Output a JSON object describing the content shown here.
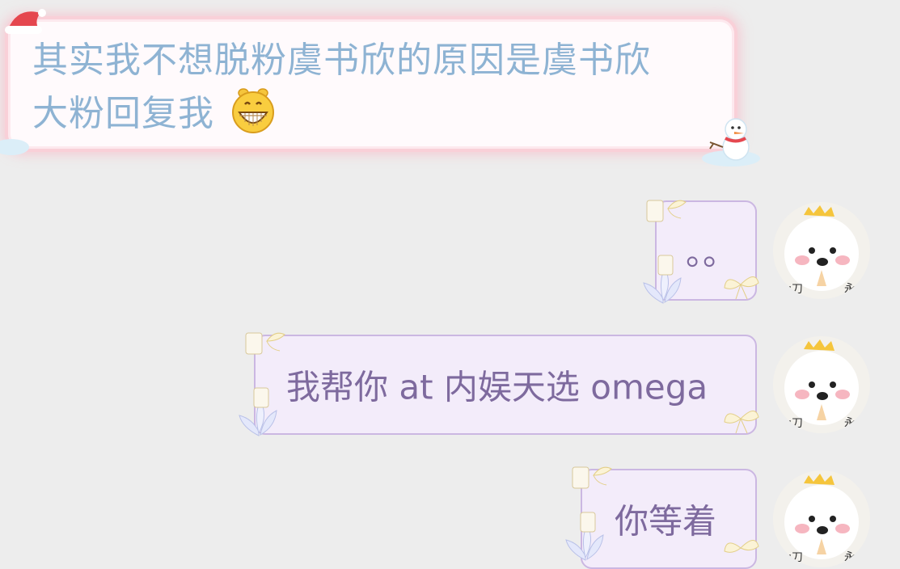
{
  "incoming": {
    "lines": [
      "其实我不想脱粉虞书欣的原因是虞书欣",
      "大粉回复我"
    ],
    "emoji": "grin-emoji"
  },
  "outgoing": [
    {
      "text": "。。"
    },
    {
      "text": "我帮你 at 内娱天选 omega"
    },
    {
      "text": "你等着"
    }
  ],
  "colors": {
    "background": "#ededed",
    "incoming_text": "#8eb3d3",
    "incoming_border": "#f9d0d8",
    "outgoing_text": "#7e6a9e",
    "outgoing_bg": "#f3ecfa",
    "outgoing_border": "#cbb7e2"
  }
}
